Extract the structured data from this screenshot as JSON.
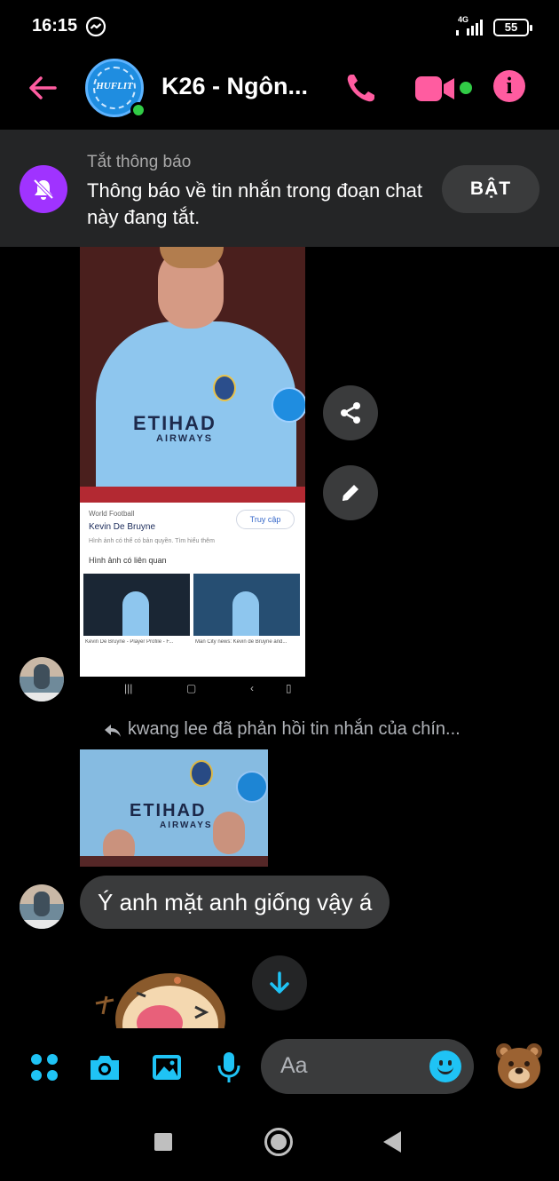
{
  "status_bar": {
    "time": "16:15",
    "network": "4G",
    "battery": "55"
  },
  "header": {
    "title": "K26 - Ngôn...",
    "avatar_logo": "HUFLIT",
    "accent_color": "#ff5ca0",
    "online_color": "#31cc46"
  },
  "mute_banner": {
    "label": "Tắt thông báo",
    "description": "Thông báo về tin nhắn trong đoạn chat này đang tắt.",
    "enable_button": "BẬT",
    "icon_color": "#a033ff"
  },
  "shared_image": {
    "sponsor": "ETIHAD",
    "sponsor_sub": "AIRWAYS",
    "source": "World Football",
    "result_title": "Kevin De Bruyne",
    "visit_button": "Truy cập",
    "copyright_note": "Hình ảnh có thể có bản quyền. Tìm hiểu thêm",
    "related_label": "Hình ảnh có liên quan",
    "caption_1": "Kevin De Bruyne - Player Profile - F...",
    "caption_2": "Man City news: Kevin de Bruyne and..."
  },
  "reply_note": "kwang lee đã phản hồi tin nhắn của chín...",
  "message": {
    "text": "Ý anh mặt anh giống vậy á"
  },
  "composer": {
    "placeholder": "Aa",
    "icon_color": "#1fc3f5"
  },
  "icons": {
    "header": [
      "back-arrow-icon",
      "phone-icon",
      "video-camera-icon",
      "info-icon"
    ],
    "actions": [
      "share-icon",
      "pencil-icon",
      "chevron-down-icon"
    ],
    "composer": [
      "grid-menu-icon",
      "camera-icon",
      "image-icon",
      "microphone-icon",
      "emoji-icon",
      "bear-sticker-icon"
    ]
  }
}
